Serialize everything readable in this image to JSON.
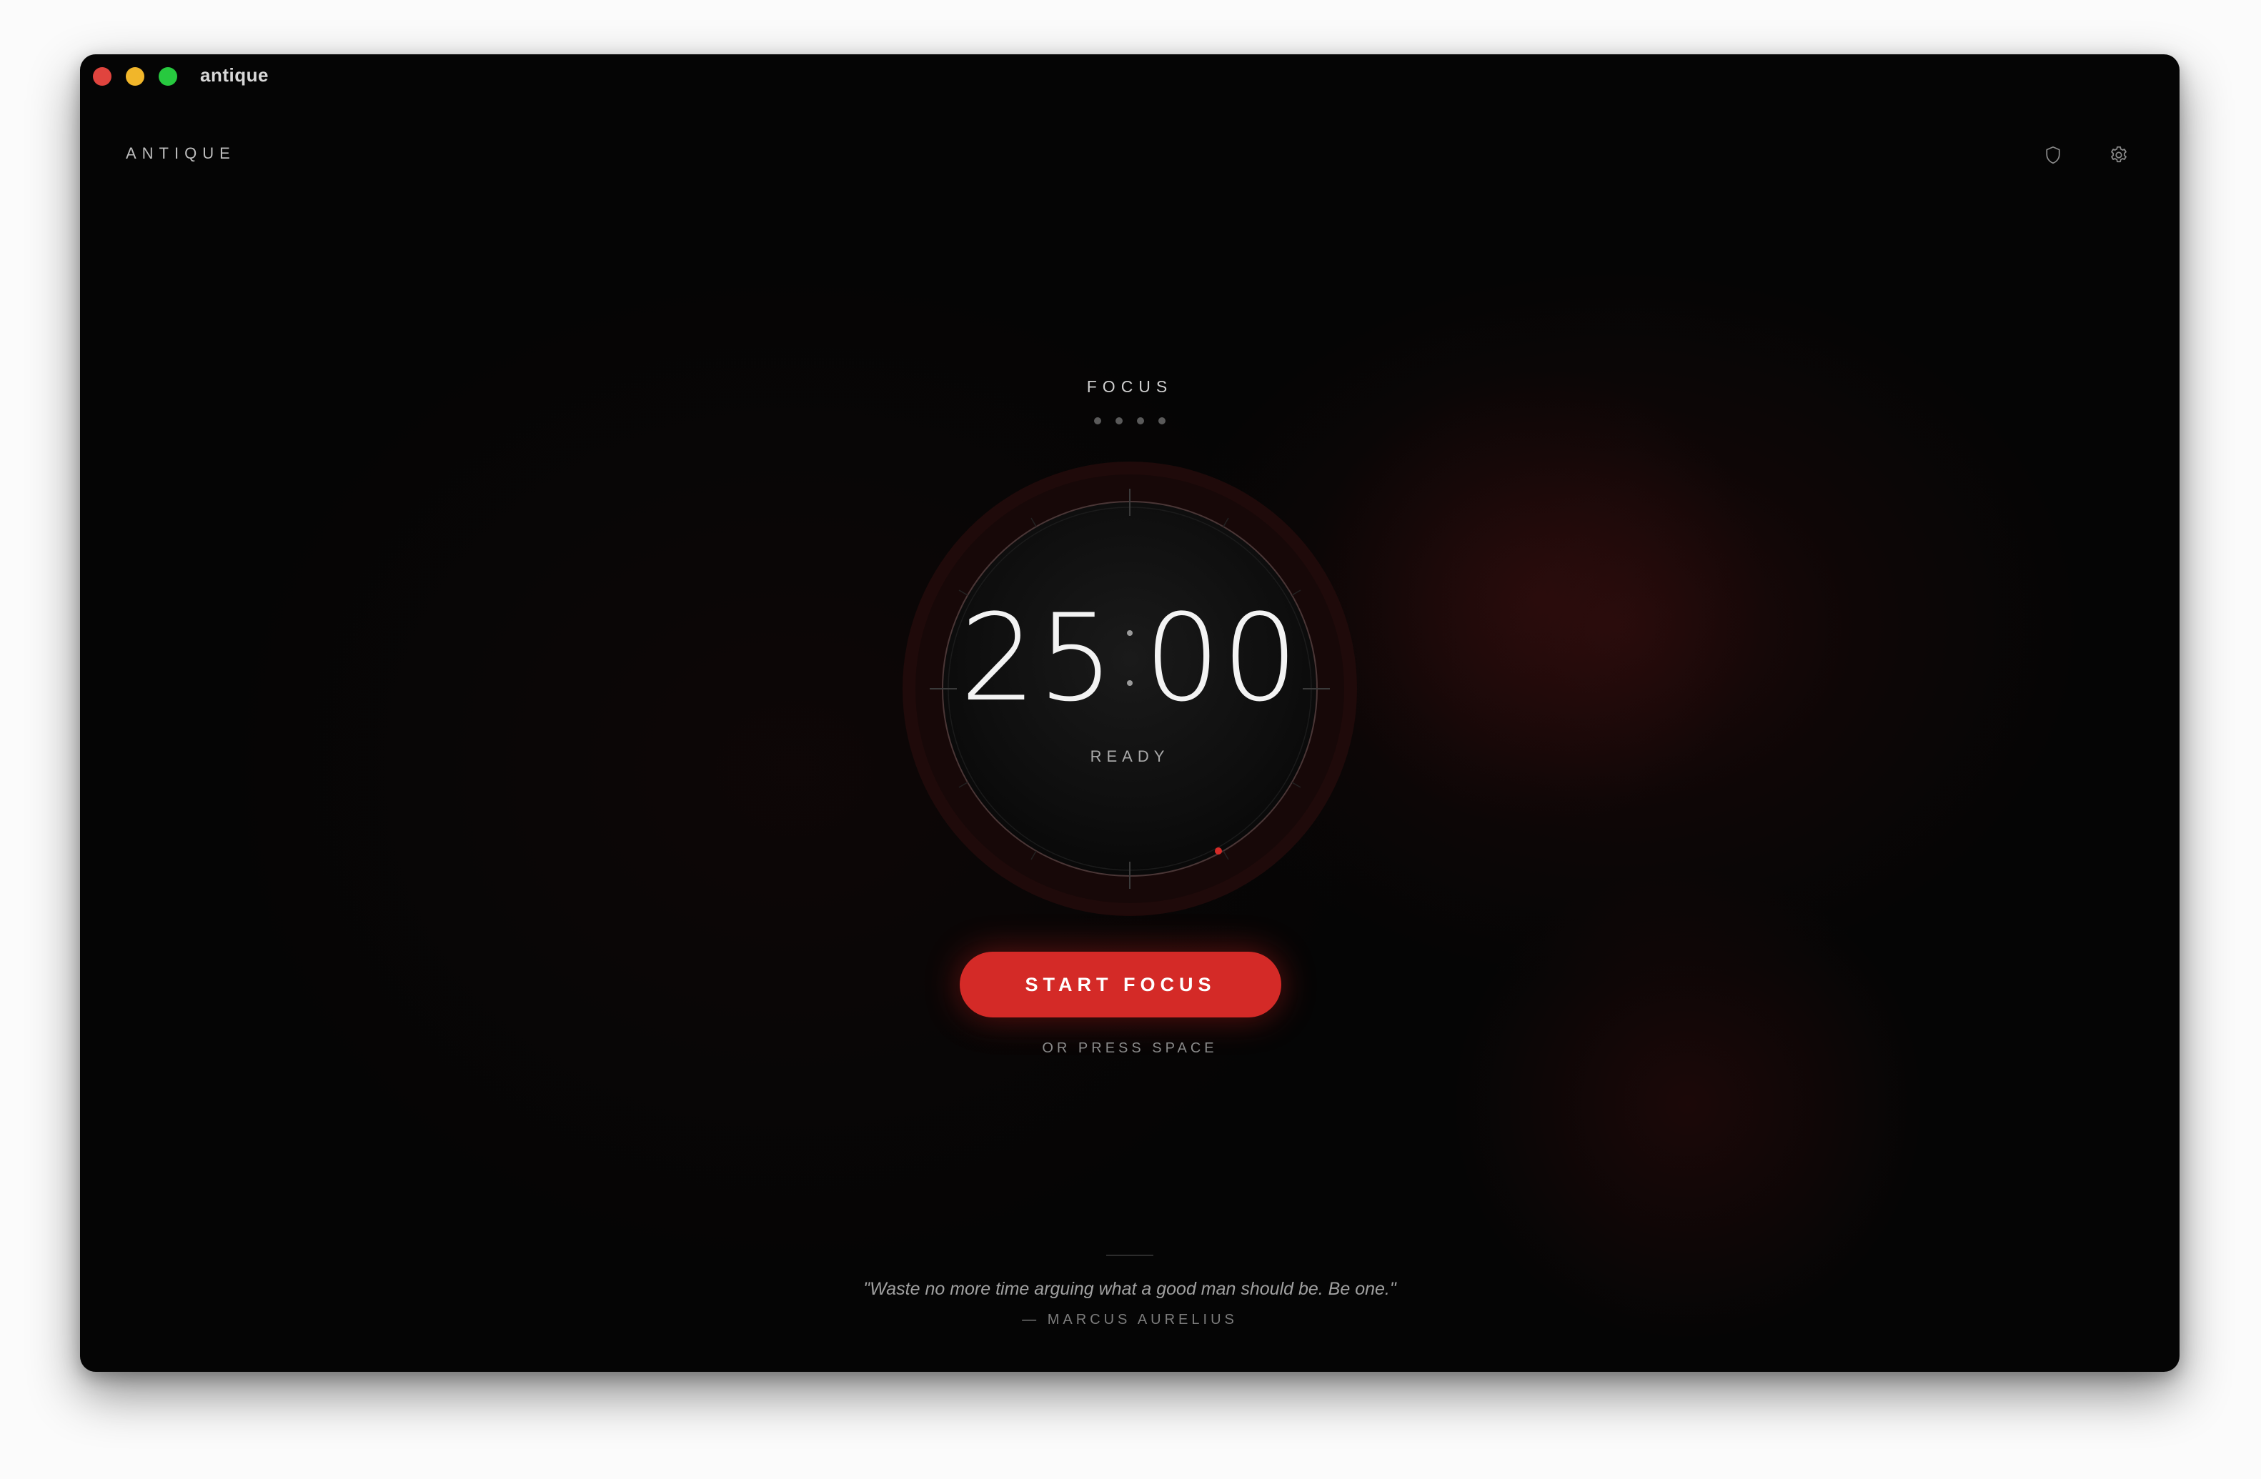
{
  "window": {
    "title": "antique",
    "controls": [
      "close",
      "minimize",
      "maximize"
    ]
  },
  "header": {
    "brand": "ANTIQUE",
    "icons": [
      "shield-icon",
      "gear-icon"
    ]
  },
  "timer": {
    "mode": "FOCUS",
    "sessions_total": 4,
    "minutes": "25",
    "seconds": "00",
    "status": "READY",
    "progress": 0
  },
  "actions": {
    "start_label": "START FOCUS",
    "hint": "OR PRESS SPACE"
  },
  "quote": {
    "text": "\"Waste no more time arguing what a good man should be. Be one.\"",
    "author": "— MARCUS AURELIUS"
  },
  "colors": {
    "accent": "#d42a27",
    "background": "#050505",
    "close": "#e0443e",
    "minimize": "#f1b62a",
    "maximize": "#27c93f"
  }
}
